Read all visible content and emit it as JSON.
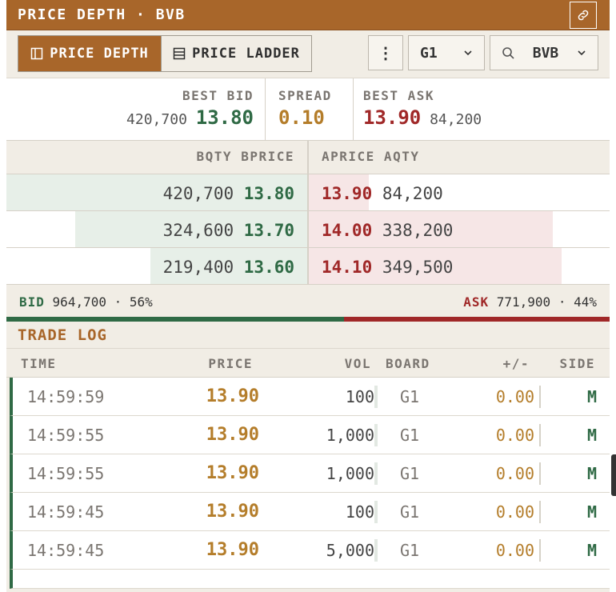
{
  "window": {
    "title": "PRICE DEPTH · BVB"
  },
  "toolbar": {
    "tab_depth": "PRICE DEPTH",
    "tab_ladder": "PRICE LADDER",
    "menu_label": "⋮",
    "board": "G1",
    "symbol": "BVB"
  },
  "best": {
    "bid_label": "BEST BID",
    "bid_qty": "420,700",
    "bid_price": "13.80",
    "spread_label": "SPREAD",
    "spread": "0.10",
    "ask_label": "BEST ASK",
    "ask_price": "13.90",
    "ask_qty": "84,200"
  },
  "depth": {
    "headers": {
      "bid": "BQTY BPRICE",
      "ask": "APRICE AQTY"
    },
    "rows": [
      {
        "bqty": "420,700",
        "bprice": "13.80",
        "aprice": "13.90",
        "aqty": "84,200",
        "bid_fill": 1.0,
        "ask_fill": 0.2
      },
      {
        "bqty": "324,600",
        "bprice": "13.70",
        "aprice": "14.00",
        "aqty": "338,200",
        "bid_fill": 0.77,
        "ask_fill": 0.81
      },
      {
        "bqty": "219,400",
        "bprice": "13.60",
        "aprice": "14.10",
        "aqty": "349,500",
        "bid_fill": 0.52,
        "ask_fill": 0.84
      }
    ],
    "totals": {
      "bid_label": "BID",
      "bid_qty": "964,700",
      "bid_pct": "56%",
      "ask_label": "ASK",
      "ask_qty": "771,900",
      "ask_pct": "44%",
      "bid_ratio": 0.56
    }
  },
  "trade_log": {
    "title": "TRADE LOG",
    "columns": {
      "time": "TIME",
      "price": "PRICE",
      "vol": "VOL",
      "board": "BOARD",
      "chg": "+/-",
      "side": "SIDE"
    },
    "rows": [
      {
        "time": "14:59:59",
        "price": "13.90",
        "vol": "100",
        "board": "G1",
        "chg": "0.00",
        "side": "M"
      },
      {
        "time": "14:59:55",
        "price": "13.90",
        "vol": "1,000",
        "board": "G1",
        "chg": "0.00",
        "side": "M"
      },
      {
        "time": "14:59:55",
        "price": "13.90",
        "vol": "1,000",
        "board": "G1",
        "chg": "0.00",
        "side": "M"
      },
      {
        "time": "14:59:45",
        "price": "13.90",
        "vol": "100",
        "board": "G1",
        "chg": "0.00",
        "side": "M"
      },
      {
        "time": "14:59:45",
        "price": "13.90",
        "vol": "5,000",
        "board": "G1",
        "chg": "0.00",
        "side": "M"
      }
    ]
  },
  "colors": {
    "accent": "#a8662a",
    "bid": "#2f6a45",
    "ask": "#a02828",
    "price": "#b47d2a"
  }
}
